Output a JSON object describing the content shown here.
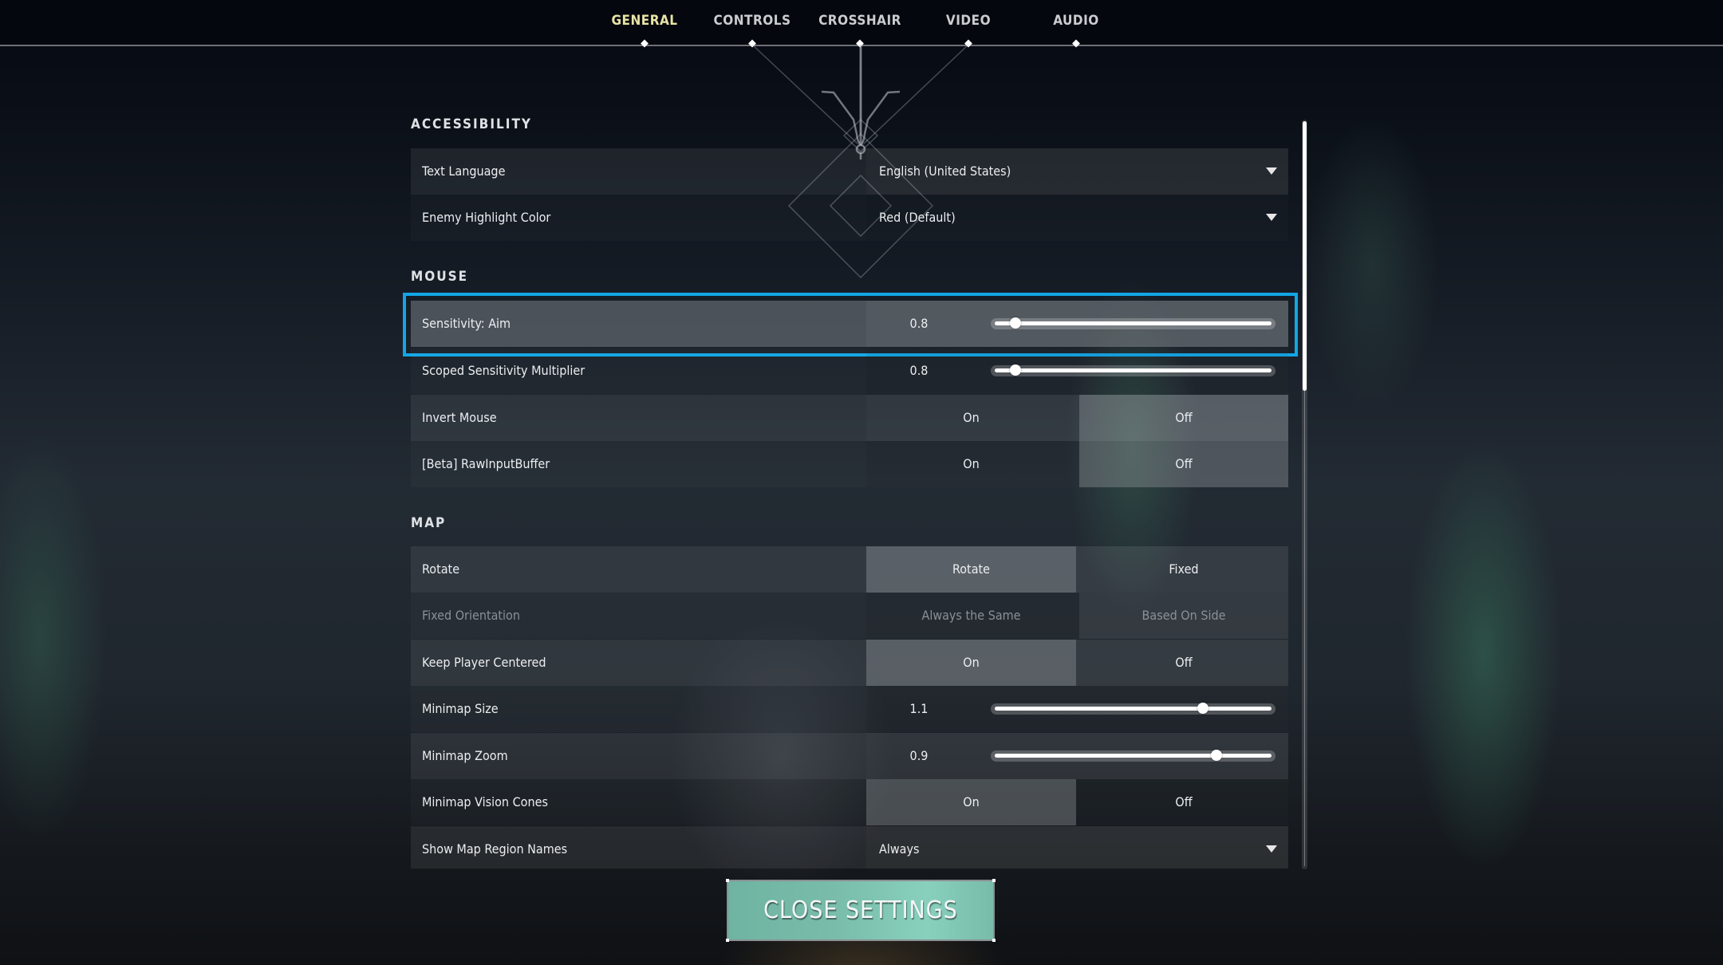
{
  "tabs": [
    {
      "label": "GENERAL",
      "active": true
    },
    {
      "label": "CONTROLS",
      "active": false
    },
    {
      "label": "CROSSHAIR",
      "active": false
    },
    {
      "label": "VIDEO",
      "active": false
    },
    {
      "label": "AUDIO",
      "active": false
    }
  ],
  "colors": {
    "active_tab": "#e8e4a6",
    "focus_outline": "#12a6e6",
    "close_button": "#79bcaa"
  },
  "sections": {
    "accessibility": {
      "title": "ACCESSIBILITY",
      "text_language": {
        "label": "Text Language",
        "value": "English (United States)",
        "icon": "chevron-down-icon"
      },
      "enemy_highlight_color": {
        "label": "Enemy Highlight Color",
        "value": "Red (Default)",
        "icon": "chevron-down-icon"
      }
    },
    "mouse": {
      "title": "MOUSE",
      "sensitivity_aim": {
        "label": "Sensitivity: Aim",
        "value": "0.8",
        "slider_fraction": 0.07
      },
      "scoped_multiplier": {
        "label": "Scoped Sensitivity Multiplier",
        "value": "0.8",
        "slider_fraction": 0.07
      },
      "invert_mouse": {
        "label": "Invert Mouse",
        "options": [
          "On",
          "Off"
        ],
        "selected": "Off"
      },
      "raw_input_buffer": {
        "label": "[Beta] RawInputBuffer",
        "options": [
          "On",
          "Off"
        ],
        "selected": "Off"
      }
    },
    "map": {
      "title": "MAP",
      "rotate": {
        "label": "Rotate",
        "options": [
          "Rotate",
          "Fixed"
        ],
        "selected": "Rotate"
      },
      "fixed_orientation": {
        "label": "Fixed Orientation",
        "options": [
          "Always the Same",
          "Based On Side"
        ],
        "selected": "Based On Side",
        "disabled": true
      },
      "keep_player_centered": {
        "label": "Keep Player Centered",
        "options": [
          "On",
          "Off"
        ],
        "selected": "On"
      },
      "minimap_size": {
        "label": "Minimap Size",
        "value": "1.1",
        "slider_fraction": 0.755
      },
      "minimap_zoom": {
        "label": "Minimap Zoom",
        "value": "0.9",
        "slider_fraction": 0.805
      },
      "minimap_vision_cones": {
        "label": "Minimap Vision Cones",
        "options": [
          "On",
          "Off"
        ],
        "selected": "On"
      },
      "show_map_region_names": {
        "label": "Show Map Region Names",
        "value": "Always",
        "icon": "chevron-down-icon"
      }
    }
  },
  "scroll": {
    "thumb_fraction_start": 0.0,
    "thumb_fraction_size": 0.36
  },
  "close_button": {
    "label": "CLOSE SETTINGS"
  }
}
